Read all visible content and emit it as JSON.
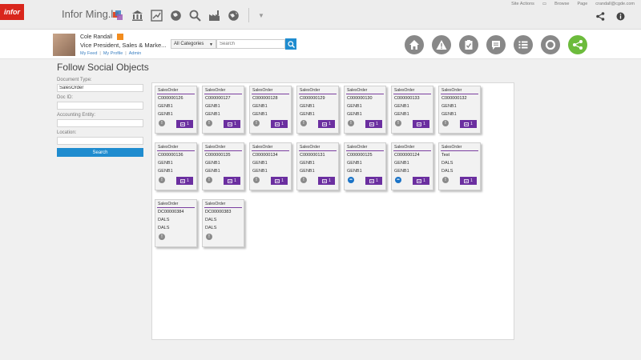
{
  "app": {
    "logo_text": "infor",
    "title": "Infor Ming.le"
  },
  "topbar": {
    "icons": [
      "stacked-squares-icon",
      "bank-icon",
      "chart-arrow-icon",
      "globe-icon",
      "magnify-icon",
      "factory-icon",
      "globe-alt-icon"
    ],
    "site_actions": "Site Actions",
    "browse": "Browse",
    "page": "Page",
    "user_email": "crandall@cgde.com"
  },
  "user": {
    "name": "Cole Randall",
    "title": "Vice President, Sales & Marke...",
    "links": [
      "My Feed",
      "My Profile",
      "Admin"
    ]
  },
  "search": {
    "category": "All Categories",
    "placeholder": "Search"
  },
  "page": {
    "title": "Follow Social Objects"
  },
  "form": {
    "doc_type_label": "Document Type:",
    "doc_type_value": "SalesOrder",
    "doc_id_label": "Doc ID:",
    "doc_id_value": "",
    "accounting_label": "Accounting Entity:",
    "accounting_value": "",
    "location_label": "Location:",
    "location_value": "",
    "search_label": "Search"
  },
  "cards": [
    {
      "type": "SalesOrder",
      "id": "C000000126",
      "l1": "GENB1",
      "l2": "GENB1",
      "follow": "1",
      "followed": false
    },
    {
      "type": "SalesOrder",
      "id": "C000000127",
      "l1": "GENB1",
      "l2": "GENB1",
      "follow": "1",
      "followed": false
    },
    {
      "type": "SalesOrder",
      "id": "C000000128",
      "l1": "GENB1",
      "l2": "GENB1",
      "follow": "1",
      "followed": false
    },
    {
      "type": "SalesOrder",
      "id": "C000000129",
      "l1": "GENB1",
      "l2": "GENB1",
      "follow": "1",
      "followed": false
    },
    {
      "type": "SalesOrder",
      "id": "C000000130",
      "l1": "GENB1",
      "l2": "GENB1",
      "follow": "1",
      "followed": false
    },
    {
      "type": "SalesOrder",
      "id": "C000000133",
      "l1": "GENB1",
      "l2": "GENB1",
      "follow": "1",
      "followed": false
    },
    {
      "type": "SalesOrder",
      "id": "C000000132",
      "l1": "GENB1",
      "l2": "GENB1",
      "follow": "1",
      "followed": false
    },
    {
      "type": "SalesOrder",
      "id": "C000000136",
      "l1": "GENB1",
      "l2": "GENB1",
      "follow": "1",
      "followed": false
    },
    {
      "type": "SalesOrder",
      "id": "C000000135",
      "l1": "GENB1",
      "l2": "GENB1",
      "follow": "1",
      "followed": false
    },
    {
      "type": "SalesOrder",
      "id": "C000000134",
      "l1": "GENB1",
      "l2": "GENB1",
      "follow": "1",
      "followed": false
    },
    {
      "type": "SalesOrder",
      "id": "C000000131",
      "l1": "GENB1",
      "l2": "GENB1",
      "follow": "1",
      "followed": false
    },
    {
      "type": "SalesOrder",
      "id": "C000000125",
      "l1": "GENB1",
      "l2": "GENB1",
      "follow": "1",
      "followed": true
    },
    {
      "type": "SalesOrder",
      "id": "C000000124",
      "l1": "GENB1",
      "l2": "GENB1",
      "follow": "1",
      "followed": true
    },
    {
      "type": "SalesOrder",
      "id": "Test",
      "l1": "DALS",
      "l2": "DALS",
      "follow": "1",
      "followed": false
    },
    {
      "type": "SalesOrder",
      "id": "DC00000384",
      "l1": "DALS",
      "l2": "DALS",
      "follow": "",
      "followed": false
    },
    {
      "type": "SalesOrder",
      "id": "DC00000383",
      "l1": "DALS",
      "l2": "DALS",
      "follow": "",
      "followed": false
    }
  ],
  "colors": {
    "accent": "#1f8ccf",
    "purple": "#6b2fa0",
    "active_nav": "#6cbb3c",
    "followed": "#1a73c7"
  }
}
